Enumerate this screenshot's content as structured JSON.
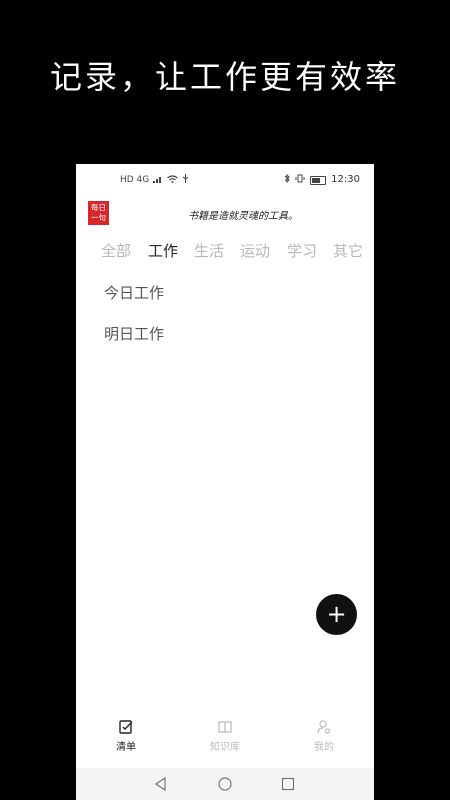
{
  "headline": "记录，让工作更有效率",
  "status_bar": {
    "left_text": "HD 4G",
    "time": "12:30"
  },
  "daily_badge": {
    "line1": "每日",
    "line2": "一句"
  },
  "quote": "书籍是造就灵魂的工具。",
  "tabs": [
    {
      "label": "全部",
      "active": false
    },
    {
      "label": "工作",
      "active": true
    },
    {
      "label": "生活",
      "active": false
    },
    {
      "label": "运动",
      "active": false
    },
    {
      "label": "学习",
      "active": false
    },
    {
      "label": "其它",
      "active": false
    }
  ],
  "tasks": [
    {
      "label": "今日工作"
    },
    {
      "label": "明日工作"
    }
  ],
  "fab_label": "+",
  "bottom_nav": [
    {
      "label": "清单",
      "icon": "checklist-icon",
      "active": true
    },
    {
      "label": "知识库",
      "icon": "book-icon",
      "active": false
    },
    {
      "label": "我的",
      "icon": "profile-settings-icon",
      "active": false
    }
  ],
  "colors": {
    "background": "#000000",
    "badge": "#d8262b",
    "fab": "#111111",
    "active_text": "#222222",
    "inactive_text": "#b8b8b8"
  }
}
